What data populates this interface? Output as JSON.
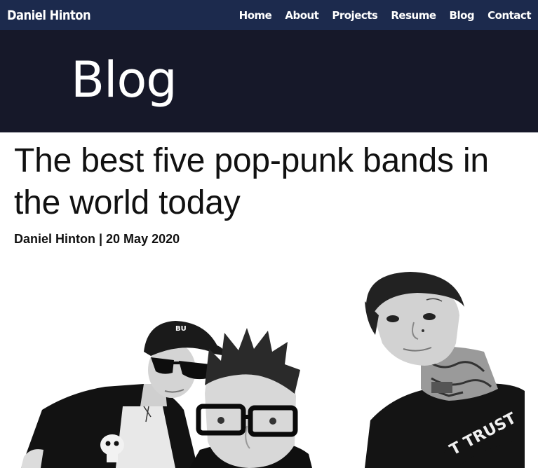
{
  "navbar": {
    "brand": "Daniel Hinton",
    "links": [
      "Home",
      "About",
      "Projects",
      "Resume",
      "Blog",
      "Contact"
    ]
  },
  "hero": {
    "title": "Blog"
  },
  "post": {
    "title": "The best five pop-punk bands in the world today",
    "author": "Daniel Hinton",
    "separator": "|",
    "date": "20 May 2020",
    "byline": "Daniel Hinton | 20 May 2020"
  },
  "photo": {
    "subject": "black-and-white band portrait",
    "shirt_text": "T TRUST",
    "cap_text": "BU"
  },
  "colors": {
    "navbar_bg": "#1c2a4d",
    "hero_bg": "#161829",
    "text_dark": "#111111",
    "white": "#ffffff"
  }
}
